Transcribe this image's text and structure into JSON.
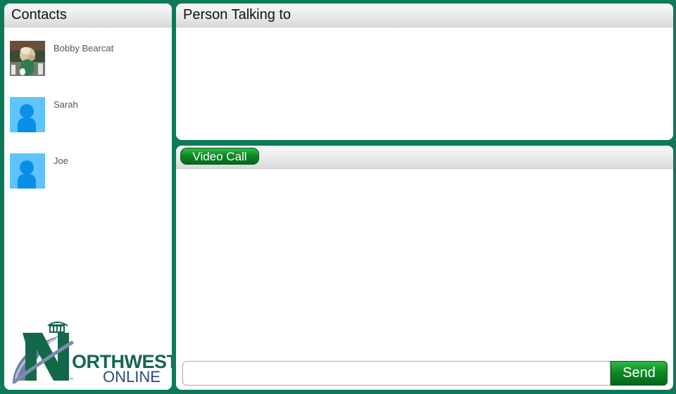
{
  "contacts": {
    "title": "Contacts",
    "items": [
      {
        "name": "Bobby Bearcat",
        "avatar": "mascot-photo"
      },
      {
        "name": "Sarah",
        "avatar": "default-person-icon"
      },
      {
        "name": "Joe",
        "avatar": "default-person-icon"
      }
    ]
  },
  "logo": {
    "line1": "NORTHWEST",
    "line1_rest": "ORTHWEST",
    "line1_initial": "N",
    "line2": "ONLINE",
    "tm": "™"
  },
  "person_panel": {
    "title": "Person Talking to"
  },
  "chat_panel": {
    "video_call_label": "Video Call",
    "message_value": "",
    "message_placeholder": "",
    "send_label": "Send"
  },
  "colors": {
    "background": "#0c7a5a",
    "accent_green": "#0e8a22",
    "avatar_blue": "#5ec3ff",
    "person_blue": "#0a8fe6",
    "logo_green": "#13684a",
    "logo_blue": "#2d4a80"
  }
}
